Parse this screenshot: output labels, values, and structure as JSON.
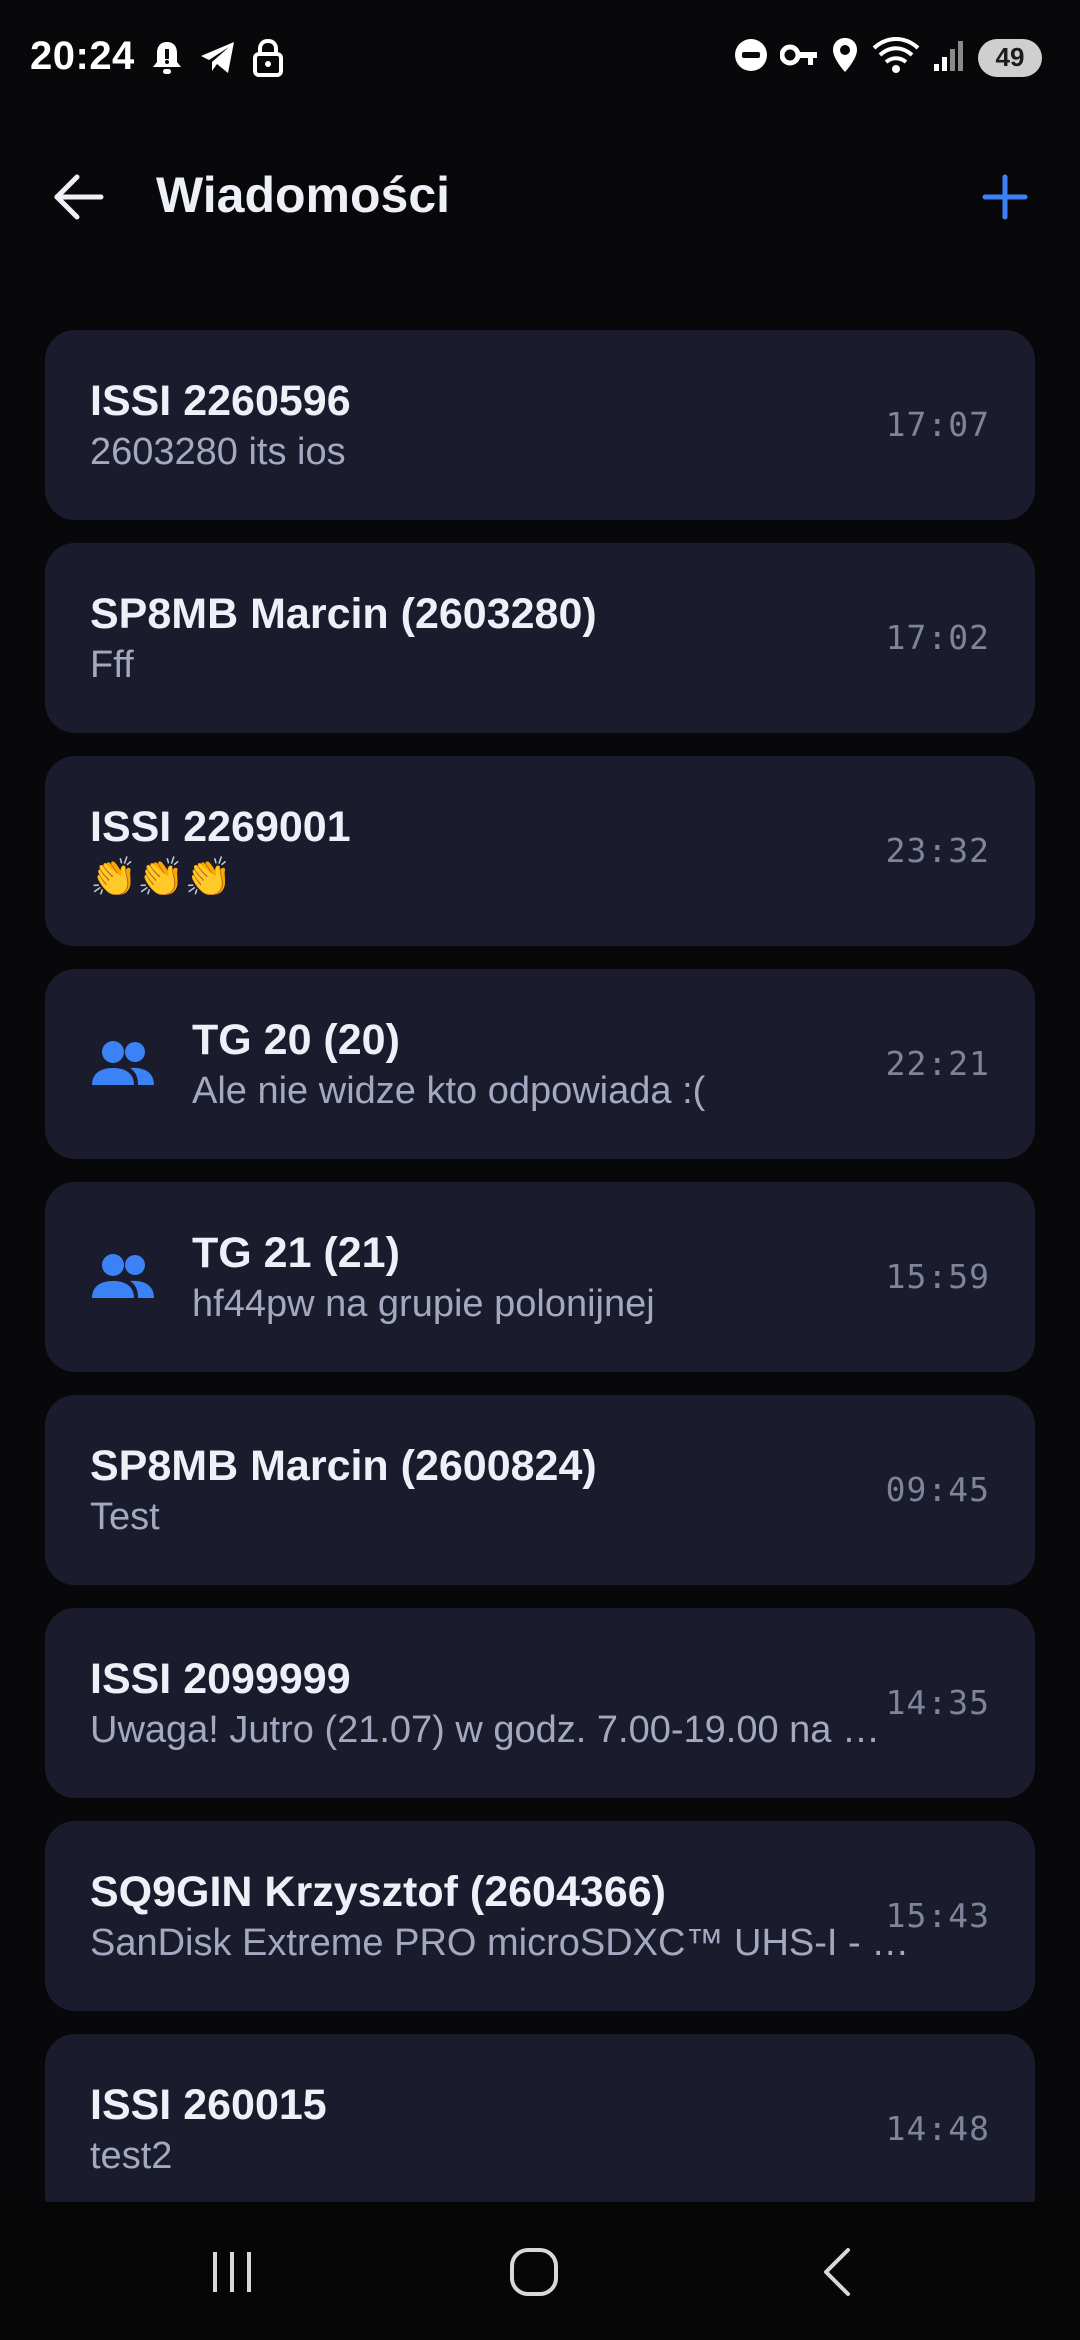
{
  "status_bar": {
    "time": "20:24",
    "left_icons": [
      "bell-icon",
      "telegram-icon",
      "lock-icon"
    ],
    "right_icons": [
      "do-not-disturb-icon",
      "vpn-key-icon",
      "location-icon",
      "wifi-icon",
      "signal-icon"
    ],
    "battery": "49"
  },
  "header": {
    "title": "Wiadomości",
    "back_icon": "arrow-left-icon",
    "add_icon": "plus-icon"
  },
  "colors": {
    "accent": "#3b82f6",
    "card_bg": "#1a1b2d",
    "background": "#08080a"
  },
  "conversations": [
    {
      "name": "ISSI 2260596",
      "preview": "2603280 its ios",
      "time": "17:07",
      "group": false
    },
    {
      "name": "SP8MB Marcin (2603280)",
      "preview": "Fff",
      "time": "17:02",
      "group": false
    },
    {
      "name": "ISSI 2269001",
      "preview": "👏👏👏",
      "time": "23:32",
      "group": false
    },
    {
      "name": "TG 20 (20)",
      "preview": "Ale nie widze kto odpowiada :(",
      "time": "22:21",
      "group": true
    },
    {
      "name": "TG 21 (21)",
      "preview": "hf44pw na grupie polonijnej",
      "time": "15:59",
      "group": true
    },
    {
      "name": "SP8MB Marcin (2600824)",
      "preview": "Test",
      "time": "09:45",
      "group": false
    },
    {
      "name": "ISSI 2099999",
      "preview": "Uwaga! Jutro (21.07) w godz. 7.00-19.00 na …",
      "time": "14:35",
      "group": false
    },
    {
      "name": "SQ9GIN Krzysztof (2604366)",
      "preview": "SanDisk Extreme PRO microSDXC™ UHS-I - 6…",
      "time": "15:43",
      "group": false
    },
    {
      "name": "ISSI 260015",
      "preview": "test2",
      "time": "14:48",
      "group": false
    }
  ],
  "nav_bar": {
    "recents_icon": "recents-icon",
    "home_icon": "home-icon",
    "back_icon": "nav-back-icon"
  }
}
